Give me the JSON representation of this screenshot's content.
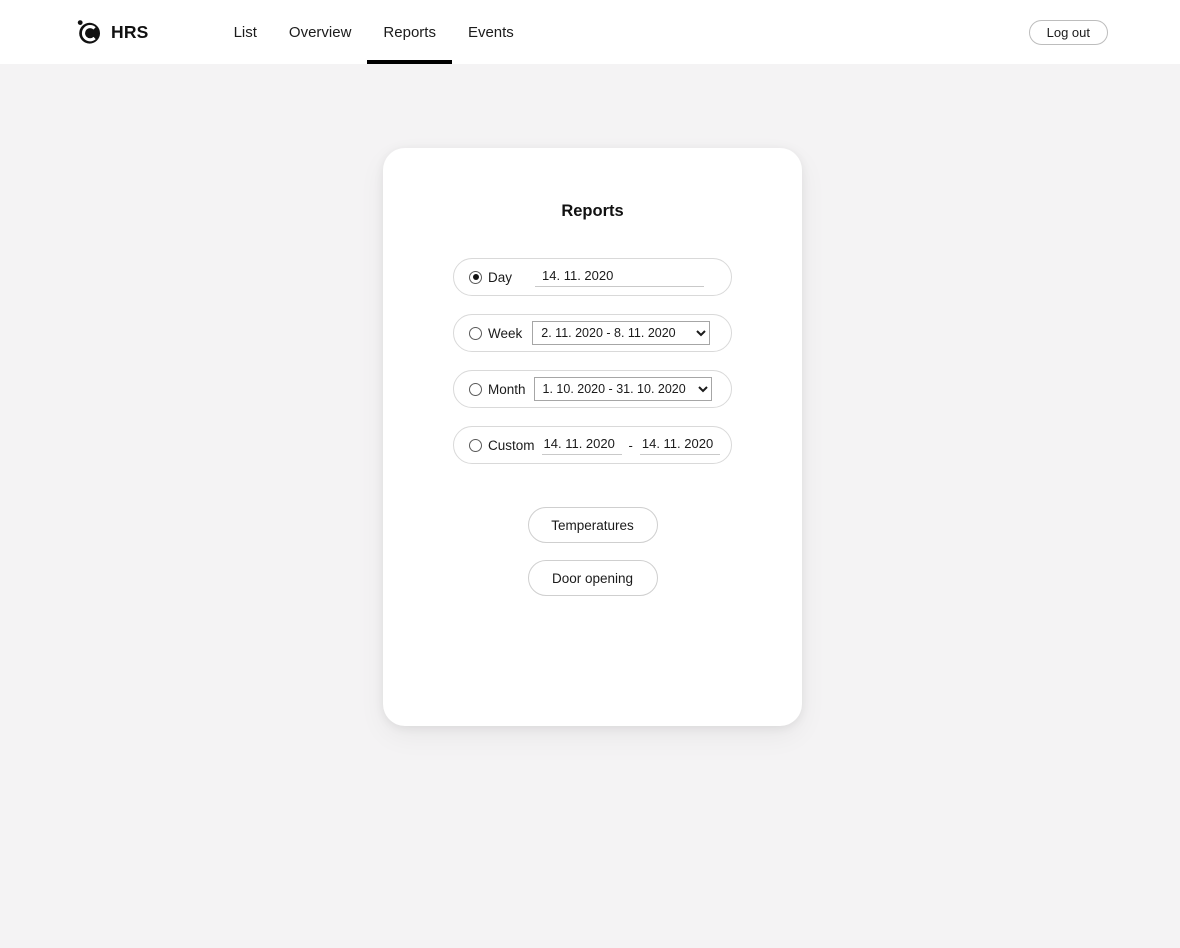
{
  "header": {
    "brand": {
      "logo_icon": "circle-c-logo-icon",
      "name": "HRS"
    },
    "nav": [
      {
        "label": "List",
        "active": false
      },
      {
        "label": "Overview",
        "active": false
      },
      {
        "label": "Reports",
        "active": true
      },
      {
        "label": "Events",
        "active": false
      }
    ],
    "logout_label": "Log out"
  },
  "card": {
    "title": "Reports",
    "options": [
      {
        "key": "day",
        "label": "Day",
        "selected": true,
        "control": "date",
        "value": "14. 11. 2020"
      },
      {
        "key": "week",
        "label": "Week",
        "selected": false,
        "control": "select",
        "value": "2. 11. 2020 - 8. 11. 2020"
      },
      {
        "key": "month",
        "label": "Month",
        "selected": false,
        "control": "select",
        "value": "1. 10. 2020 - 31. 10. 2020"
      },
      {
        "key": "custom",
        "label": "Custom",
        "selected": false,
        "control": "date-range",
        "value_from": "14. 11. 2020",
        "separator": "-",
        "value_to": "14. 11. 2020"
      }
    ],
    "actions": [
      {
        "label": "Temperatures"
      },
      {
        "label": "Door opening"
      }
    ]
  },
  "colors": {
    "page_background": "#f4f3f4",
    "header_background": "#ffffff",
    "card_background": "#ffffff",
    "text": "#1b1b1b",
    "active_tab_underline": "#000000",
    "pill_border": "#d9d9d9"
  }
}
